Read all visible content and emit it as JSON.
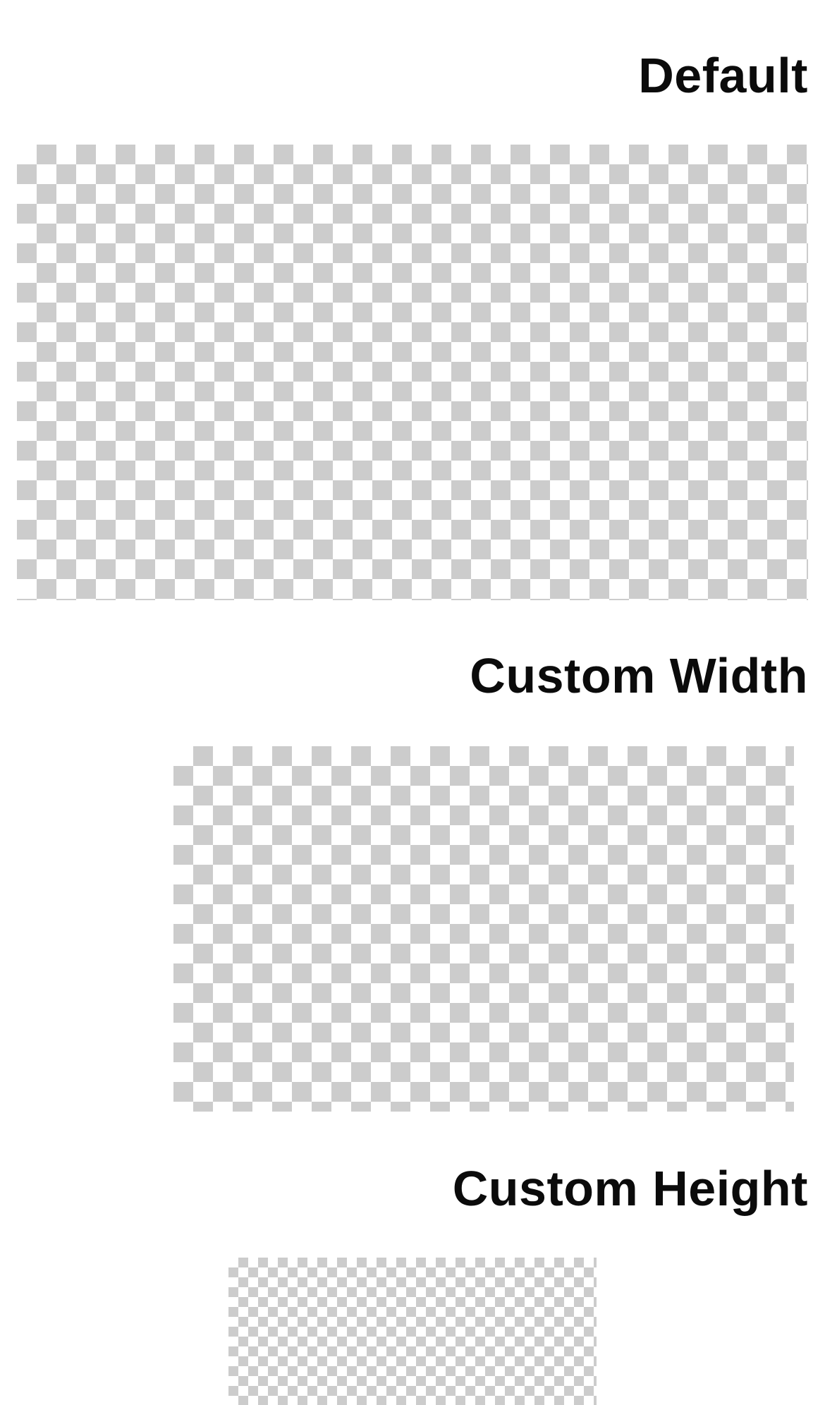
{
  "sections": [
    {
      "title": "Default",
      "image": "transparent-checkerboard-placeholder"
    },
    {
      "title": "Custom Width",
      "image": "transparent-checkerboard-placeholder"
    },
    {
      "title": "Custom Height",
      "image": "transparent-checkerboard-placeholder"
    }
  ],
  "colors": {
    "background": "#ffffff",
    "title_text": "#0b0b0b",
    "checker_dark": "#cccccc",
    "checker_light": "#ffffff"
  }
}
